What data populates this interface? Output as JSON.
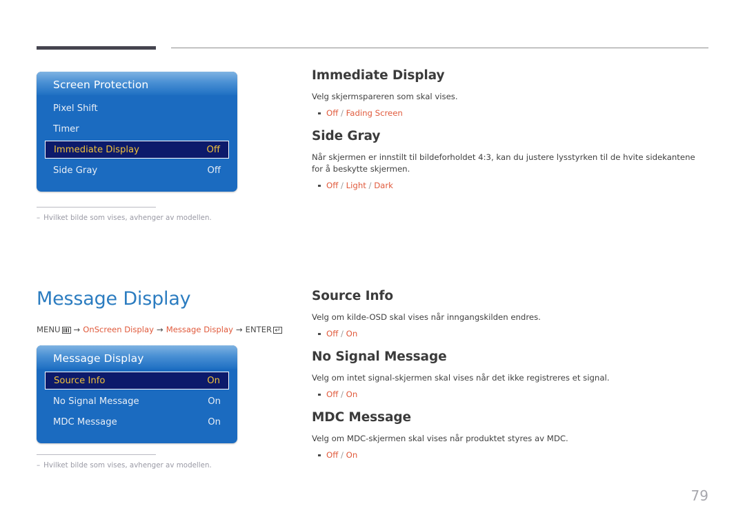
{
  "colors": {
    "accent_blue": "#2b7cc0",
    "accent_orange": "#e05a3c",
    "osd_blue": "#1b6bc0",
    "osd_selected_bg": "#0c1a6b",
    "osd_selected_text": "#f0c13b",
    "heading_gray": "#3b3b3b",
    "note_gray": "#9a9aa5",
    "rule_dark": "#45444f"
  },
  "osd_panels": [
    {
      "title": "Screen Protection",
      "rows": [
        {
          "label": "Pixel Shift",
          "value": "",
          "selected": false
        },
        {
          "label": "Timer",
          "value": "",
          "selected": false
        },
        {
          "label": "Immediate Display",
          "value": "Off",
          "selected": true
        },
        {
          "label": "Side Gray",
          "value": "Off",
          "selected": false
        }
      ]
    },
    {
      "title": "Message Display",
      "rows": [
        {
          "label": "Source Info",
          "value": "On",
          "selected": true
        },
        {
          "label": "No Signal Message",
          "value": "On",
          "selected": false
        },
        {
          "label": "MDC Message",
          "value": "On",
          "selected": false
        }
      ]
    }
  ],
  "notes": [
    {
      "dash": "–",
      "text": "Hvilket bilde som vises, avhenger av modellen."
    },
    {
      "dash": "–",
      "text": "Hvilket bilde som vises, avhenger av modellen."
    }
  ],
  "section": {
    "title": "Message Display",
    "breadcrumb": {
      "menu_label": "MENU",
      "menu_icon": "menu-bars-icon",
      "arrow": "→",
      "path_1": "OnScreen Display",
      "path_2": "Message Display",
      "enter_label": "ENTER",
      "enter_icon": "enter-return-icon"
    }
  },
  "right_sections": [
    {
      "id": "immediate-display",
      "heading": "Immediate Display",
      "paragraph": "Velg skjermspareren som skal vises.",
      "options": [
        "Off",
        "Fading Screen"
      ]
    },
    {
      "id": "side-gray",
      "heading": "Side Gray",
      "paragraph": "Når skjermen er innstilt til bildeforholdet 4:3, kan du justere lysstyrken til de hvite sidekantene for å beskytte skjermen.",
      "options": [
        "Off",
        "Light",
        "Dark"
      ]
    },
    {
      "id": "source-info",
      "heading": "Source Info",
      "paragraph": "Velg om kilde-OSD skal vises når inngangskilden endres.",
      "options": [
        "Off",
        "On"
      ]
    },
    {
      "id": "no-signal-message",
      "heading": "No Signal Message",
      "paragraph": "Velg om intet signal-skjermen skal vises når det ikke registreres et signal.",
      "options": [
        "Off",
        "On"
      ]
    },
    {
      "id": "mdc-message",
      "heading": "MDC Message",
      "paragraph": "Velg om MDC-skjermen skal vises når produktet styres av MDC.",
      "options": [
        "Off",
        "On"
      ]
    }
  ],
  "page_number": "79"
}
